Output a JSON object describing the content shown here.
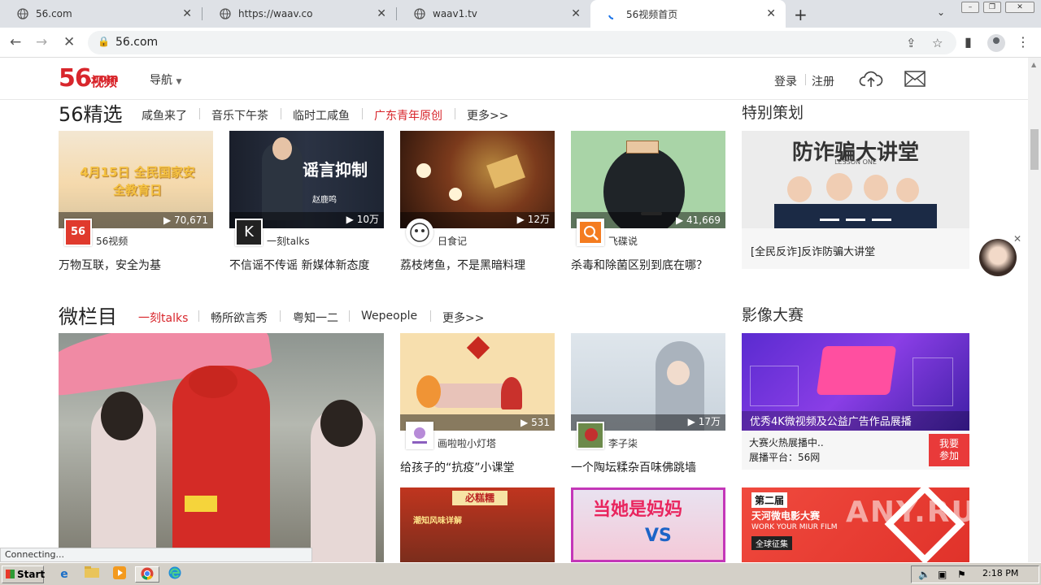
{
  "browser": {
    "tabs": [
      {
        "title": "56.com"
      },
      {
        "title": "https://waav.co"
      },
      {
        "title": "waav1.tv"
      },
      {
        "title": "56视频首页"
      }
    ],
    "url": "56.com",
    "status": "Connecting..."
  },
  "site": {
    "logo_main": "56",
    "logo_sub": "视频",
    "logo_com": ".com",
    "nav_label": "导航",
    "login": "登录",
    "register": "注册"
  },
  "featured": {
    "title": "56精选",
    "links": [
      "咸鱼来了",
      "音乐下午茶",
      "临时工咸鱼",
      "广东青年原创",
      "更多>>"
    ],
    "videos": [
      {
        "count": "70,671",
        "channel": "56视频",
        "title": "万物互联，安全为基",
        "thumb_text": "4月15日 全民国家安全教育日"
      },
      {
        "count": "10万",
        "channel": "一刻talks",
        "title": "不信谣不传谣 新媒体新态度",
        "thumb_text": "谣言抑制",
        "thumb_name": "赵鹿鸣"
      },
      {
        "count": "12万",
        "channel": "日食记",
        "title": "荔枝烤鱼，不是黑暗料理"
      },
      {
        "count": "41,669",
        "channel": "飞碟说",
        "title": "杀毒和除菌区别到底在哪？"
      }
    ]
  },
  "special": {
    "title": "特别策划",
    "banner_text": "防诈骗大讲堂",
    "banner_sub": "LESSON ONE",
    "caption": "[全民反诈]反诈防骗大讲堂"
  },
  "micro": {
    "title": "微栏目",
    "links": [
      "一刻talks",
      "畅所欲言秀",
      "粤知一二",
      "Wepeople",
      "更多>>"
    ],
    "videos": [
      {
        "count": "531",
        "channel": "画啦啦小灯塔",
        "title": "给孩子的“抗疫”小课堂"
      },
      {
        "count": "17万",
        "channel": "李子柒",
        "title": "一个陶坛糅杂百味佛跳墙"
      }
    ]
  },
  "contest": {
    "title": "影像大赛",
    "banner_caption": "优秀4K微视频及公益广告作品展播",
    "line1": "大赛火热展播中..",
    "line2": "展播平台：56网",
    "join": "我要参加",
    "poster_title": "第二届",
    "poster_sub": "天河微电影大赛",
    "poster_en": "WORK YOUR MIUR FILM",
    "poster_call": "全球征集"
  },
  "lower_thumbs": {
    "food_sign": "必糕糯",
    "food_top": "潮知风味详解",
    "mom_text": "当她是妈妈",
    "mom_vs": "VS"
  },
  "watermark": "ANY.RUN",
  "taskbar": {
    "start": "Start",
    "time": "2:18 PM"
  },
  "colors": {
    "brand_red": "#d8262c",
    "tab_bg": "#dee1e6",
    "taskbar": "#d4d0c8"
  }
}
